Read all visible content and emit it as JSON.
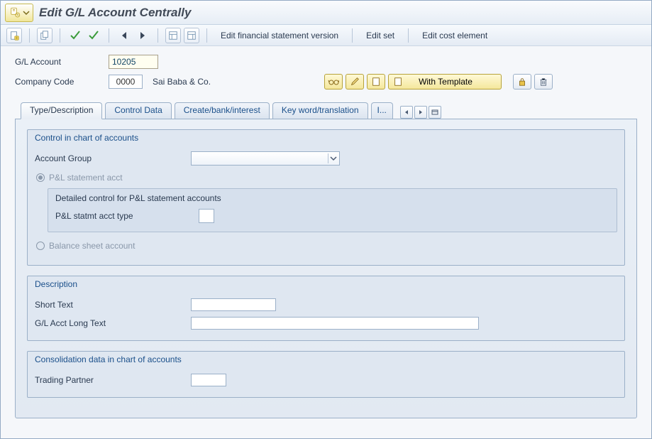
{
  "title": "Edit G/L Account Centrally",
  "toolbar": {
    "link_financial": "Edit financial statement version",
    "link_editset": "Edit set",
    "link_costelement": "Edit cost element"
  },
  "fields": {
    "gl_label": "G/L Account",
    "gl_value": "10205",
    "cc_label": "Company Code",
    "cc_value": "0000",
    "cc_desc": "Sai Baba & Co."
  },
  "actions": {
    "with_template": "With Template"
  },
  "tabs": [
    "Type/Description",
    "Control Data",
    "Create/bank/interest",
    "Key word/translation",
    "I..."
  ],
  "group1": {
    "title": "Control in chart of accounts",
    "accgroup_label": "Account Group",
    "radio_pl": "P&L statement acct",
    "sub_title": "Detailed control for P&L statement accounts",
    "sub_label": "P&L statmt acct type",
    "radio_bs": "Balance sheet account"
  },
  "group2": {
    "title": "Description",
    "short_label": "Short Text",
    "long_label": "G/L Acct Long Text"
  },
  "group3": {
    "title": "Consolidation data in chart of accounts",
    "tp_label": "Trading Partner"
  }
}
